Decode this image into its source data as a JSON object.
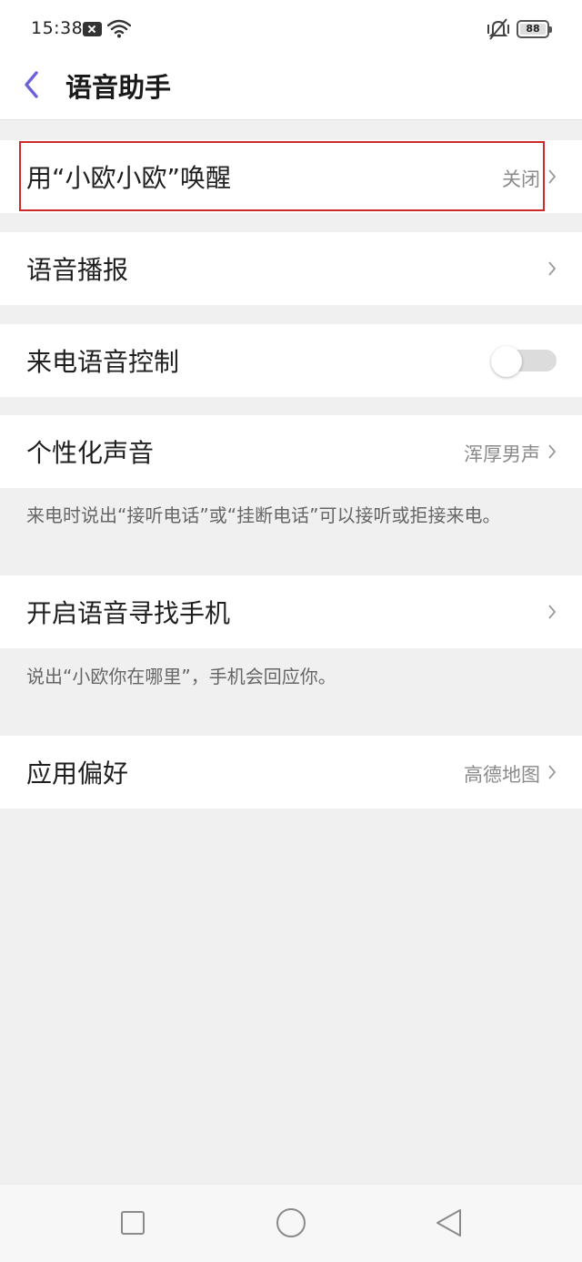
{
  "status_bar": {
    "time": "15:38",
    "battery": "88",
    "icons": [
      "notification-icon",
      "wifi-icon",
      "vibrate-icon",
      "battery-icon"
    ]
  },
  "header": {
    "title": "语音助手",
    "back_icon": "chevron-left-icon",
    "accent_color": "#6c63d8"
  },
  "rows": {
    "wake": {
      "label": "用“小欧小欧”唤醒",
      "value": "关闭"
    },
    "broadcast": {
      "label": "语音播报",
      "value": ""
    },
    "call_control": {
      "label": "来电语音控制",
      "toggle_on": false
    },
    "voice": {
      "label": "个性化声音",
      "value": "浑厚男声"
    },
    "find_phone": {
      "label": "开启语音寻找手机",
      "value": ""
    },
    "app_pref": {
      "label": "应用偏好",
      "value": "高德地图"
    }
  },
  "hints": {
    "call_hint": "来电时说出“接听电话”或“挂断电话”可以接听或拒接来电。",
    "find_hint": "说出“小欧你在哪里”，手机会回应你。"
  },
  "nav_bar": {
    "buttons": [
      "recent-apps-icon",
      "home-icon",
      "back-triangle-icon"
    ]
  },
  "colors": {
    "highlight": "#cc2b2b",
    "background": "#f0f0f0"
  }
}
